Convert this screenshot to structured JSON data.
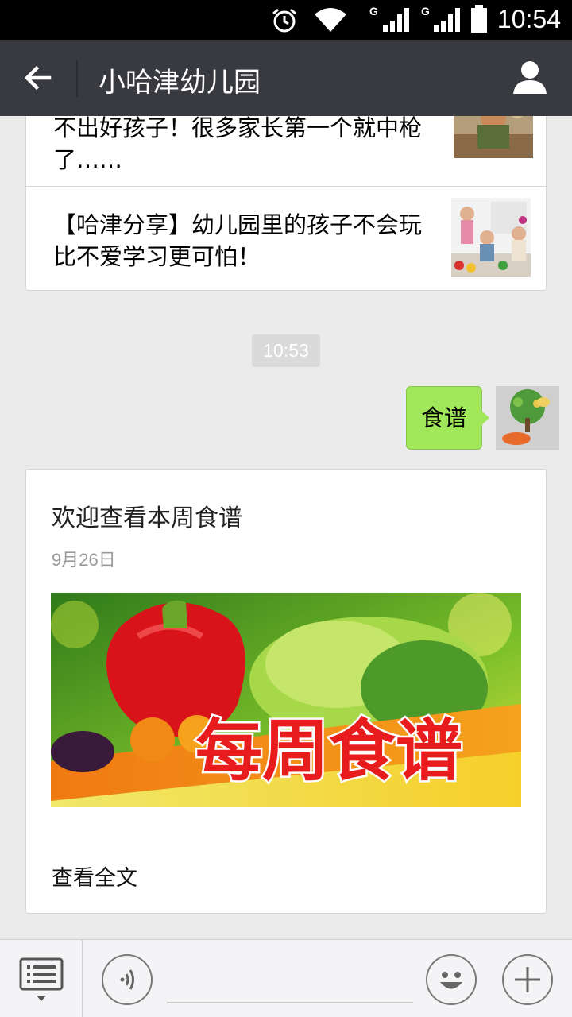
{
  "status_bar": {
    "time": "10:54",
    "icons": [
      "alarm-icon",
      "wifi-icon",
      "signal-icon",
      "signal-icon",
      "battery-icon"
    ],
    "network_labels": [
      "G",
      "G"
    ]
  },
  "title_bar": {
    "title": "小哈津幼儿园",
    "icons": [
      "back-arrow-icon",
      "contact-icon"
    ]
  },
  "news_items": [
    {
      "text": "不出好孩子！很多家长第一个就中枪了……"
    },
    {
      "text": "【哈津分享】幼儿园里的孩子不会玩比不爱学习更可怕！"
    }
  ],
  "chat": {
    "timestamp": "10:53",
    "sent_message": "食谱",
    "article": {
      "title": "欢迎查看本周食谱",
      "date": "9月26日",
      "banner_text": "每周食谱",
      "read_more": "查看全文"
    }
  },
  "bottom_bar": {
    "icons": [
      "menu-list-icon",
      "voice-icon",
      "emoji-icon",
      "plus-icon"
    ]
  },
  "colors": {
    "title_bar": "#393a3f",
    "chat_bg": "#ebebeb",
    "sent_bubble": "#a0e75a",
    "banner_text": "#e81c1c"
  }
}
